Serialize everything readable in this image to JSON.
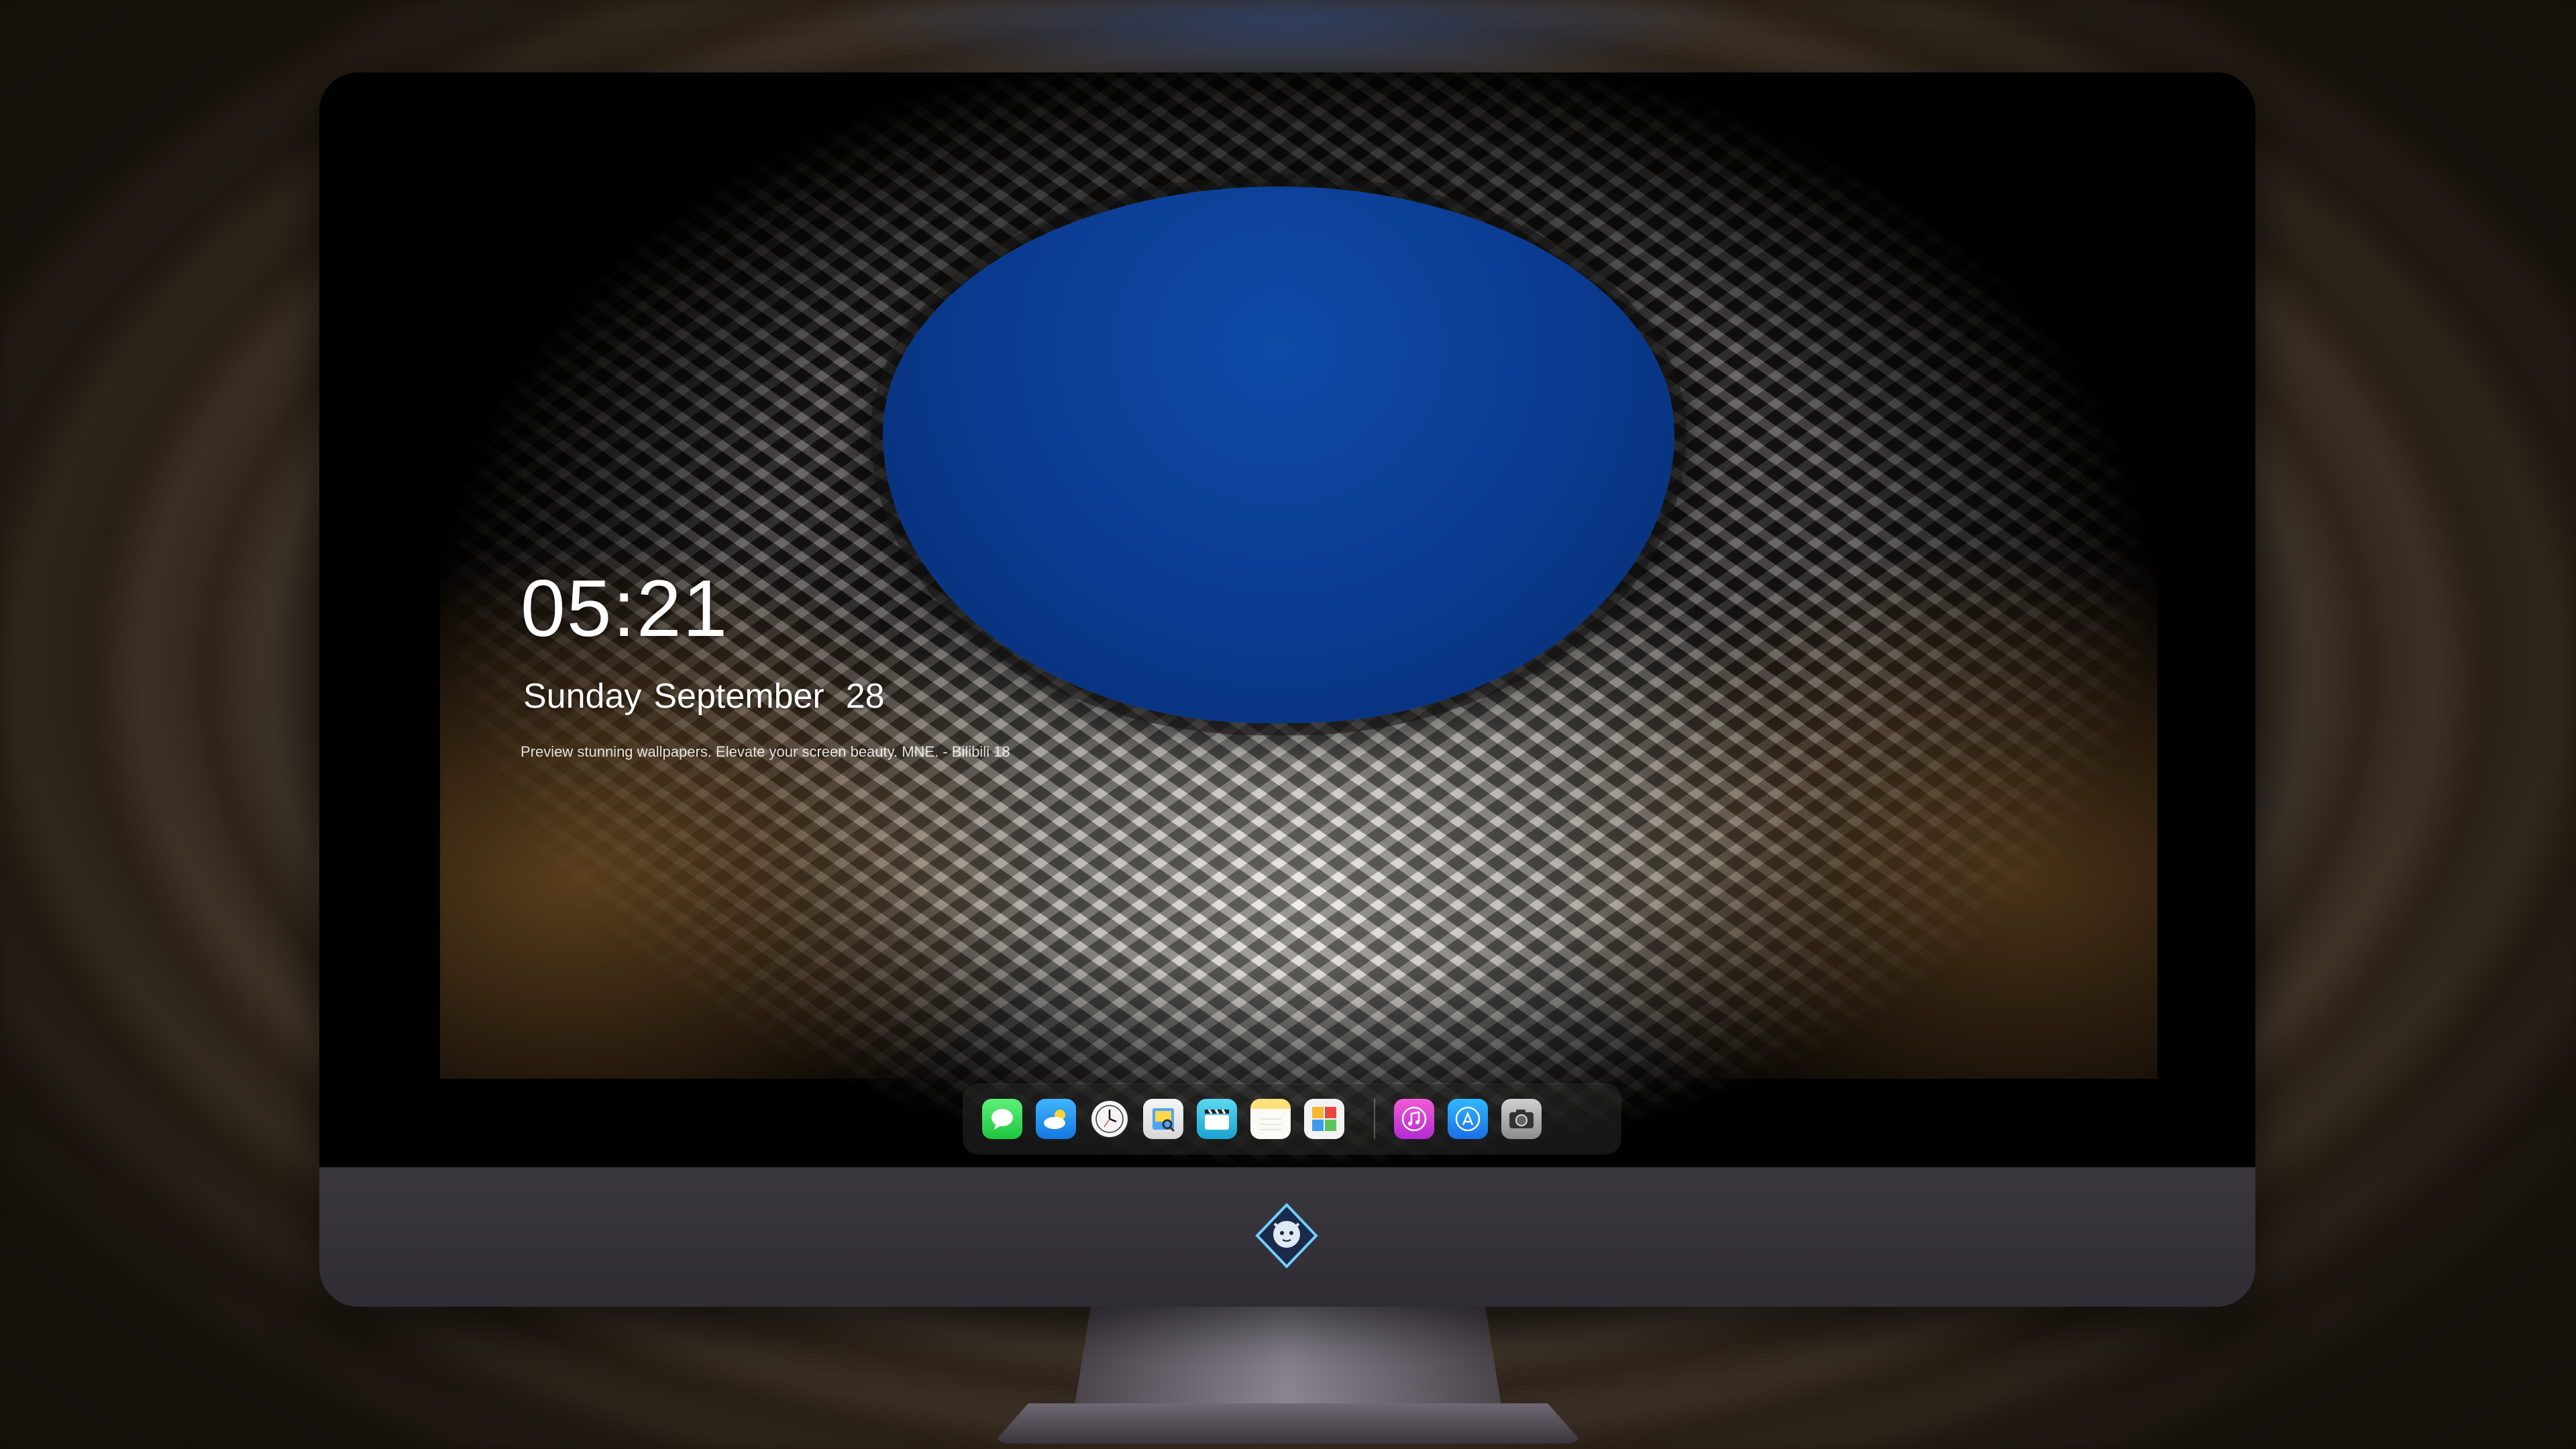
{
  "lock_screen": {
    "time": "05:21",
    "weekday": "Sunday",
    "month": "September",
    "day": "28",
    "caption": "Preview stunning wallpapers. Elevate your screen beauty. MNE. - Bilibili 18"
  },
  "dock": {
    "apps": [
      {
        "name": "messages-icon"
      },
      {
        "name": "weather-icon"
      },
      {
        "name": "clock-icon"
      },
      {
        "name": "preview-icon"
      },
      {
        "name": "clips-icon"
      },
      {
        "name": "notes-icon"
      },
      {
        "name": "photos-icon"
      },
      {
        "name": "music-icon"
      },
      {
        "name": "app-store-icon"
      },
      {
        "name": "camera-icon"
      }
    ]
  },
  "colors": {
    "sky": "#0a3a8f",
    "dock_bg": "#282828",
    "bezel_chin": "#37333a"
  }
}
